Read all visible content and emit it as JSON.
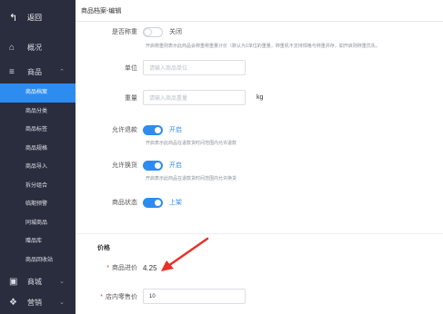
{
  "sidebar": {
    "back_label": "返回",
    "overview_label": "概况",
    "goods_label": "商品",
    "sub_items": [
      "商品档案",
      "商品分类",
      "商品标签",
      "商品规格",
      "商品导入",
      "拆分组合",
      "临期预警",
      "同城商品",
      "赠品库",
      "商品回收站"
    ],
    "mall_label": "商城",
    "last_label": "营销"
  },
  "topbar": {
    "breadcrumb": "商品档案-编辑"
  },
  "form": {
    "weighing": {
      "label": "是否称重",
      "state": "关闭",
      "hint": "开启称重则表示此商品会称重称重量计价（默认为1单位的重量，称重机不支持规格与称重并存，如开启则称重优先，"
    },
    "unit": {
      "label": "单位",
      "placeholder": "请输入商品单位"
    },
    "weight": {
      "label": "重量",
      "placeholder": "请输入商品重量",
      "unit": "kg"
    },
    "refund": {
      "label": "允许退款",
      "state": "开启",
      "hint": "开启表示此商品在退款货时间范围内允许退款"
    },
    "exchange": {
      "label": "允许换货",
      "state": "开启",
      "hint": "开启表示此商品在退款货时间范围内允许换货"
    },
    "status": {
      "label": "商品状态",
      "state": "上架"
    }
  },
  "price": {
    "section_title": "价格",
    "purchase": {
      "label": "商品进价",
      "value": "4.25"
    },
    "retail": {
      "label": "店内零售价",
      "value": "10"
    }
  },
  "colors": {
    "accent": "#2d8cf0",
    "sidebar": "#2a2d3e",
    "required": "#e23c3c",
    "arrow": "#e8312a"
  }
}
